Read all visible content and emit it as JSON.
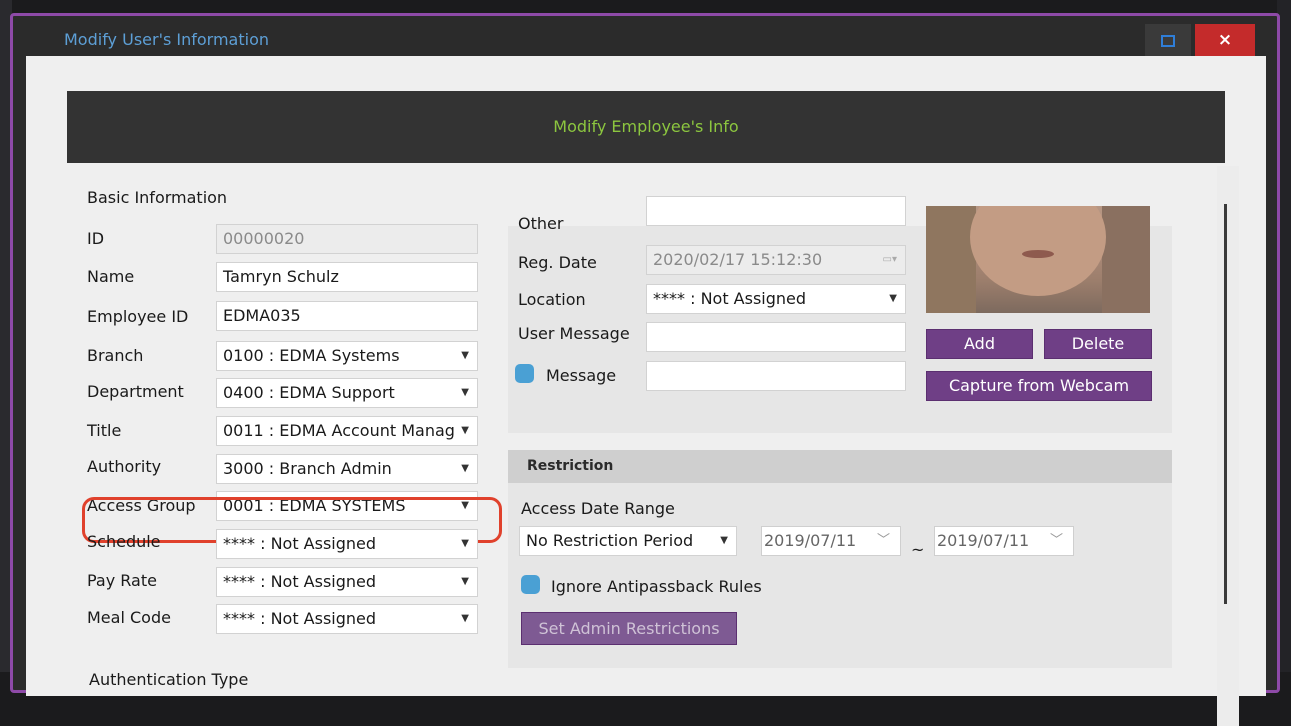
{
  "window": {
    "title": "Modify User's Information",
    "close_label": "×",
    "maximize_icon": "maximize-icon"
  },
  "header": {
    "title": "Modify Employee's Info"
  },
  "basic": {
    "section_label": "Basic Information",
    "fields": {
      "id": {
        "label": "ID",
        "value": "00000020"
      },
      "name": {
        "label": "Name",
        "value": "Tamryn Schulz"
      },
      "employee_id": {
        "label": "Employee ID",
        "value": "EDMA035"
      },
      "branch": {
        "label": "Branch",
        "value": "0100 : EDMA Systems"
      },
      "department": {
        "label": "Department",
        "value": "0400 : EDMA Support"
      },
      "title": {
        "label": "Title",
        "value": "0011 : EDMA Account Manag"
      },
      "authority": {
        "label": "Authority",
        "value": "3000 : Branch Admin"
      },
      "access_group": {
        "label": "Access Group",
        "value": "0001 : EDMA SYSTEMS"
      },
      "schedule": {
        "label": "Schedule",
        "value": "**** : Not Assigned"
      },
      "pay_rate": {
        "label": "Pay Rate",
        "value": "**** : Not Assigned"
      },
      "meal_code": {
        "label": "Meal Code",
        "value": "**** : Not Assigned"
      }
    },
    "authentication_label": "Authentication Type"
  },
  "other_info": {
    "other": {
      "label": "Other",
      "value": ""
    },
    "reg_date": {
      "label": "Reg. Date",
      "value": "2020/02/17 15:12:30"
    },
    "location": {
      "label": "Location",
      "value": "**** : Not Assigned"
    },
    "user_message": {
      "label": "User Message",
      "value": ""
    },
    "message": {
      "label": "Message",
      "value": ""
    }
  },
  "photo": {
    "add_label": "Add",
    "delete_label": "Delete",
    "webcam_label": "Capture from Webcam"
  },
  "restriction": {
    "heading": "Restriction",
    "access_date_range_label": "Access Date Range",
    "period_value": "No Restriction Period",
    "date_from": "2019/07/11",
    "date_to": "2019/07/11",
    "range_sep": "~",
    "antipassback_label": "Ignore Antipassback Rules",
    "admin_button_label": "Set Admin Restrictions"
  },
  "colors": {
    "accent_purple": "#6f3f86",
    "header_text": "#8cc63f",
    "highlight": "#e0412c",
    "title_text": "#5d9fd6",
    "checkbox": "#4aa0d4"
  }
}
